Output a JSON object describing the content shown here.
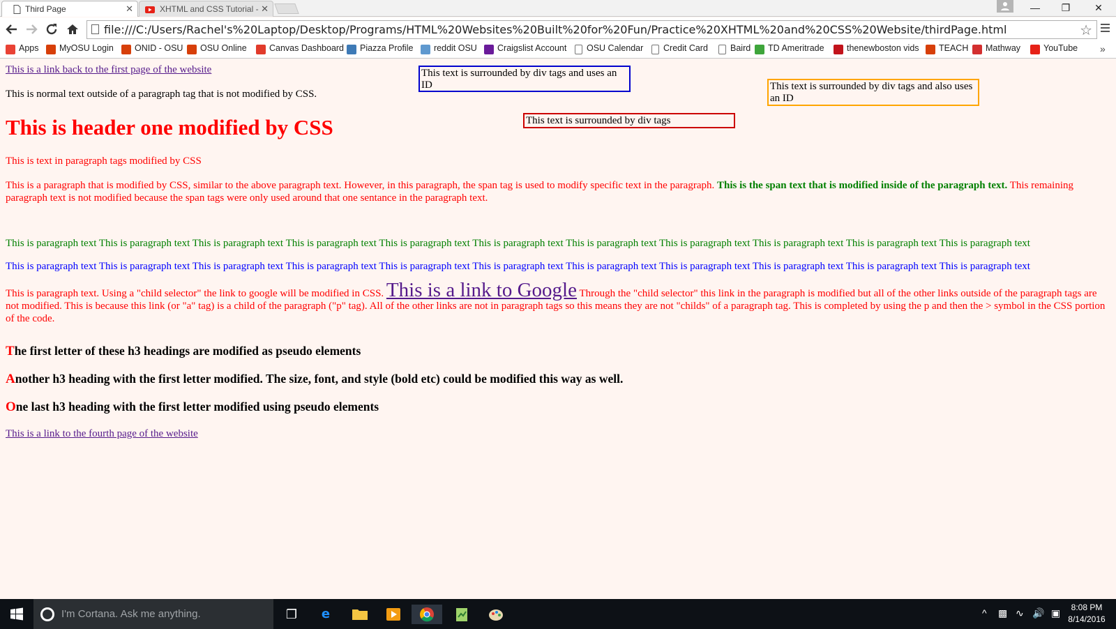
{
  "browser": {
    "tabs": [
      {
        "title": "Third Page",
        "active": true
      },
      {
        "title": "XHTML and CSS Tutorial -",
        "active": false
      }
    ],
    "address": "file:///C:/Users/Rachel's%20Laptop/Desktop/Programs/HTML%20Websites%20Built%20for%20Fun/Practice%20XHTML%20and%20CSS%20Website/thirdPage.html",
    "bookmarks": [
      {
        "label": "Apps",
        "icon": "apps-grid-icon",
        "color": "#e94235"
      },
      {
        "label": "MyOSU Login",
        "icon": "myosu-icon",
        "color": "#d73f09"
      },
      {
        "label": "ONID - OSU",
        "icon": "osu-icon",
        "color": "#d73f09"
      },
      {
        "label": "OSU Online",
        "icon": "osu-icon",
        "color": "#d73f09"
      },
      {
        "label": "Canvas Dashboard",
        "icon": "canvas-icon",
        "color": "#e13b2b"
      },
      {
        "label": "Piazza Profile",
        "icon": "piazza-icon",
        "color": "#3e7ab6"
      },
      {
        "label": "reddit OSU",
        "icon": "reddit-icon",
        "color": "#5f99cf"
      },
      {
        "label": "Craigslist Account",
        "icon": "peace-icon",
        "color": "#6a1b9a"
      },
      {
        "label": "OSU Calendar",
        "icon": "page-icon",
        "color": "#ffffff"
      },
      {
        "label": "Credit Card",
        "icon": "page-icon",
        "color": "#ffffff"
      },
      {
        "label": "Baird",
        "icon": "page-icon",
        "color": "#ffffff"
      },
      {
        "label": "TD Ameritrade",
        "icon": "td-icon",
        "color": "#3ea53b"
      },
      {
        "label": "thenewboston vids",
        "icon": "thenewboston-icon",
        "color": "#c2131b"
      },
      {
        "label": "TEACH",
        "icon": "osu-coe-icon",
        "color": "#d73f09"
      },
      {
        "label": "Mathway",
        "icon": "mathway-icon",
        "color": "#d32f2f"
      },
      {
        "label": "YouTube",
        "icon": "youtube-icon",
        "color": "#e62117"
      }
    ]
  },
  "page": {
    "link_first_page": "This is a link back to the first page of the website",
    "normal_text": "This is normal text outside of a paragraph tag that is not modified by CSS.",
    "header_one": "This is header one modified by CSS",
    "para_modified": "This is text in paragraph tags modified by CSS",
    "para_span_before": "This is a paragraph that is modified by CSS, similar to the above paragraph text. However, in this paragraph, the span tag is used to modify specific text in the paragraph.",
    "para_span_text": "This is the span text that is modified inside of the paragraph text.",
    "para_span_after": "This remaining paragraph text is not modified because the span tags were only used around that one sentance in the paragraph text.",
    "green_line": "This is paragraph text This is paragraph text This is paragraph text This is paragraph text This is paragraph text This is paragraph text This is paragraph text This is paragraph text This is paragraph text This is paragraph text This is paragraph text",
    "blue_line": "This is paragraph text This is paragraph text This is paragraph text This is paragraph text This is paragraph text This is paragraph text This is paragraph text This is paragraph text This is paragraph text This is paragraph text This is paragraph text",
    "child_before": "This is paragraph text. Using a \"child selector\" the link to google will be modified in CSS.",
    "child_link": "This is a link to Google",
    "child_after": "Through the \"child selector\" this link in the paragraph is modified but all of the other links outside of the paragraph tags are not modified. This is because this link (or \"a\" tag) is a child of the paragraph (\"p\" tag). All of the other links are not in paragraph tags so this means they are not \"childs\" of a paragraph tag. This is completed by using the p and then the > symbol in the CSS portion of the code.",
    "h3_1_first": "T",
    "h3_1_rest": "he first letter of these h3 headings are modified as pseudo elements",
    "h3_2_first": "A",
    "h3_2_rest": "nother h3 heading with the first letter modified. The size, font, and style (bold etc) could be modified this way as well.",
    "h3_3_first": "O",
    "h3_3_rest": "ne last h3 heading with the first letter modified using pseudo elements",
    "link_fourth_page": "This is a link to the fourth page of the website",
    "div_blue": "This text is surrounded by div tags and uses an ID",
    "div_red": "This text is surrounded by div tags",
    "div_orange": "This text is surrounded by div tags and also uses an ID"
  },
  "taskbar": {
    "cortana_placeholder": "I'm Cortana. Ask me anything.",
    "time": "8:08 PM",
    "date": "8/14/2016"
  },
  "colors": {
    "page_bg": "#fff5f1",
    "red_text": "#ff0000",
    "green_text": "#008000",
    "blue_text": "#0000ff",
    "link": "#551a8b",
    "div_blue_border": "#0000cd",
    "div_red_border": "#cc0000",
    "div_orange_border": "#ffa500"
  }
}
